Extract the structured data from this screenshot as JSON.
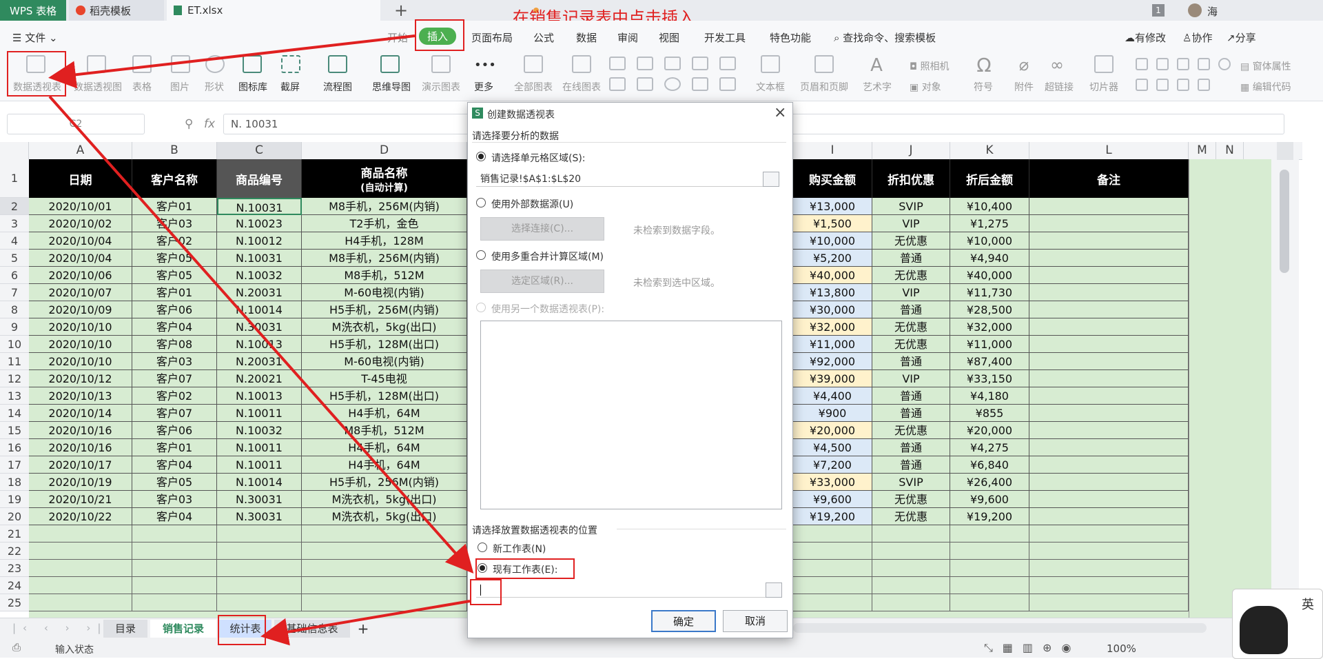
{
  "app_tabs": {
    "wps": "WPS 表格",
    "daoke": "稻壳模板",
    "file": "ET.xlsx",
    "add": "+",
    "badge": "1",
    "user": "海"
  },
  "annotation": "在销售记录表中点击插入",
  "menu": {
    "file": "文件",
    "items": [
      "开始",
      "插入",
      "页面布局",
      "公式",
      "数据",
      "审阅",
      "视图",
      "开发工具",
      "特色功能"
    ],
    "search": "查找命令、搜索模板",
    "right": [
      "有修改",
      "协作",
      "分享"
    ]
  },
  "ribbon": {
    "items": [
      "数据透视表",
      "数据透视图",
      "表格",
      "图片",
      "形状",
      "图标库",
      "截屏",
      "流程图",
      "思维导图",
      "演示图表",
      "更多",
      "全部图表",
      "在线图表",
      "文本框",
      "页眉和页脚",
      "艺术字",
      "符号",
      "附件",
      "超链接",
      "切片器"
    ],
    "small": [
      "照相机",
      "对象",
      "窗体属性",
      "编辑代码"
    ]
  },
  "formula_bar": {
    "name_box": "C2",
    "fx": "fx",
    "value": "N. 10031"
  },
  "columns": [
    "A",
    "B",
    "C",
    "D",
    "I",
    "J",
    "K",
    "L",
    "M",
    "N"
  ],
  "headers": {
    "date": "日期",
    "customer": "客户名称",
    "code": "商品编号",
    "product": "商品名称",
    "product_sub": "(自动计算)",
    "amount": "购买金额",
    "discount": "折扣优惠",
    "after": "折后金额",
    "note": "备注"
  },
  "rows": [
    {
      "n": "2",
      "date": "2020/10/01",
      "cust": "客户01",
      "code": "N.10031",
      "prod": "M8手机，256M(内销)",
      "amt": "¥13,000",
      "disc": "SVIP",
      "after": "¥10,400"
    },
    {
      "n": "3",
      "date": "2020/10/02",
      "cust": "客户03",
      "code": "N.10023",
      "prod": "T2手机，金色",
      "amt": "¥1,500",
      "disc": "VIP",
      "after": "¥1,275"
    },
    {
      "n": "4",
      "date": "2020/10/04",
      "cust": "客户02",
      "code": "N.10012",
      "prod": "H4手机，128M",
      "amt": "¥10,000",
      "disc": "无优惠",
      "after": "¥10,000"
    },
    {
      "n": "5",
      "date": "2020/10/04",
      "cust": "客户05",
      "code": "N.10031",
      "prod": "M8手机，256M(内销)",
      "amt": "¥5,200",
      "disc": "普通",
      "after": "¥4,940"
    },
    {
      "n": "6",
      "date": "2020/10/06",
      "cust": "客户05",
      "code": "N.10032",
      "prod": "M8手机，512M",
      "amt": "¥40,000",
      "disc": "无优惠",
      "after": "¥40,000"
    },
    {
      "n": "7",
      "date": "2020/10/07",
      "cust": "客户01",
      "code": "N.20031",
      "prod": "M-60电视(内销)",
      "amt": "¥13,800",
      "disc": "VIP",
      "after": "¥11,730"
    },
    {
      "n": "8",
      "date": "2020/10/09",
      "cust": "客户06",
      "code": "N.10014",
      "prod": "H5手机，256M(内销)",
      "amt": "¥30,000",
      "disc": "普通",
      "after": "¥28,500"
    },
    {
      "n": "9",
      "date": "2020/10/10",
      "cust": "客户04",
      "code": "N.30031",
      "prod": "M洗衣机，5kg(出口)",
      "amt": "¥32,000",
      "disc": "无优惠",
      "after": "¥32,000"
    },
    {
      "n": "10",
      "date": "2020/10/10",
      "cust": "客户08",
      "code": "N.10013",
      "prod": "H5手机，128M(出口)",
      "amt": "¥11,000",
      "disc": "无优惠",
      "after": "¥11,000"
    },
    {
      "n": "11",
      "date": "2020/10/10",
      "cust": "客户03",
      "code": "N.20031",
      "prod": "M-60电视(内销)",
      "amt": "¥92,000",
      "disc": "普通",
      "after": "¥87,400"
    },
    {
      "n": "12",
      "date": "2020/10/12",
      "cust": "客户07",
      "code": "N.20021",
      "prod": "T-45电视",
      "amt": "¥39,000",
      "disc": "VIP",
      "after": "¥33,150"
    },
    {
      "n": "13",
      "date": "2020/10/13",
      "cust": "客户02",
      "code": "N.10013",
      "prod": "H5手机，128M(出口)",
      "amt": "¥4,400",
      "disc": "普通",
      "after": "¥4,180"
    },
    {
      "n": "14",
      "date": "2020/10/14",
      "cust": "客户07",
      "code": "N.10011",
      "prod": "H4手机，64M",
      "amt": "¥900",
      "disc": "普通",
      "after": "¥855"
    },
    {
      "n": "15",
      "date": "2020/10/16",
      "cust": "客户06",
      "code": "N.10032",
      "prod": "M8手机，512M",
      "amt": "¥20,000",
      "disc": "无优惠",
      "after": "¥20,000"
    },
    {
      "n": "16",
      "date": "2020/10/16",
      "cust": "客户01",
      "code": "N.10011",
      "prod": "H4手机，64M",
      "amt": "¥4,500",
      "disc": "普通",
      "after": "¥4,275"
    },
    {
      "n": "17",
      "date": "2020/10/17",
      "cust": "客户04",
      "code": "N.10011",
      "prod": "H4手机，64M",
      "amt": "¥7,200",
      "disc": "普通",
      "after": "¥6,840"
    },
    {
      "n": "18",
      "date": "2020/10/19",
      "cust": "客户05",
      "code": "N.10014",
      "prod": "H5手机，256M(内销)",
      "amt": "¥33,000",
      "disc": "SVIP",
      "after": "¥26,400"
    },
    {
      "n": "19",
      "date": "2020/10/21",
      "cust": "客户03",
      "code": "N.30031",
      "prod": "M洗衣机，5kg(出口)",
      "amt": "¥9,600",
      "disc": "无优惠",
      "after": "¥9,600"
    },
    {
      "n": "20",
      "date": "2020/10/22",
      "cust": "客户04",
      "code": "N.30031",
      "prod": "M洗衣机，5kg(出口)",
      "amt": "¥19,200",
      "disc": "无优惠",
      "after": "¥19,200"
    }
  ],
  "empty_rows": [
    "21",
    "22",
    "23",
    "24",
    "25"
  ],
  "sheets": [
    "目录",
    "销售记录",
    "统计表",
    "基础信息表",
    "+"
  ],
  "status": {
    "left": "输入状态",
    "zoom": "100%"
  },
  "ime": "英",
  "dialog": {
    "title": "创建数据透视表",
    "section1": "请选择要分析的数据",
    "opt_range": "请选择单元格区域(S):",
    "range_value": "销售记录!$A$1:$L$20",
    "opt_external": "使用外部数据源(U)",
    "btn_conn": "选择连接(C)...",
    "conn_note": "未检索到数据字段。",
    "opt_multi": "使用多重合并计算区域(M)",
    "btn_area": "选定区域(R)...",
    "area_note": "未检索到选中区域。",
    "opt_other": "使用另一个数据透视表(P):",
    "section2": "请选择放置数据透视表的位置",
    "opt_new": "新工作表(N)",
    "opt_existing": "现有工作表(E):",
    "ok": "确定",
    "cancel": "取消"
  },
  "colors": {
    "accent_green": "#2f8a5e",
    "annotation_red": "#e02020",
    "header_black": "#000000",
    "cell_green": "#d7ecd2"
  }
}
